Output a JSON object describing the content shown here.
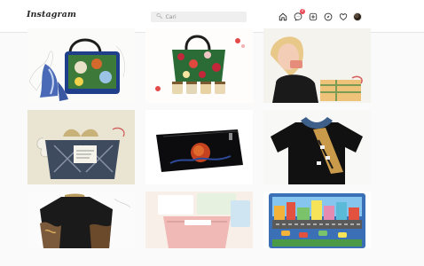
{
  "brand": {
    "logo_text": "Instagram"
  },
  "search": {
    "placeholder": "Cari"
  },
  "nav": {
    "items": [
      "home-icon",
      "messenger-icon",
      "new-post-icon",
      "explore-icon",
      "activity-heart-icon",
      "profile-avatar"
    ],
    "messages_badge": "2"
  },
  "colors": {
    "badge": "#ed4956",
    "icon": "#262626",
    "bar_bg": "#ffffff",
    "page_bg": "#fafafa"
  },
  "posts": [
    {
      "subject": "floral-batik-handbag-with-scarf"
    },
    {
      "subject": "red-floral-tote-bag-with-jars"
    },
    {
      "subject": "woman-holding-gift-box"
    },
    {
      "subject": "wrapped-fabric-gift-bundle"
    },
    {
      "subject": "black-pouch-with-red-moon-print"
    },
    {
      "subject": "black-shirt-with-denim-scarf"
    },
    {
      "subject": "black-batik-dress"
    },
    {
      "subject": "pink-pouch-with-pastel-items"
    },
    {
      "subject": "colorful-city-scene-play-mat"
    }
  ]
}
